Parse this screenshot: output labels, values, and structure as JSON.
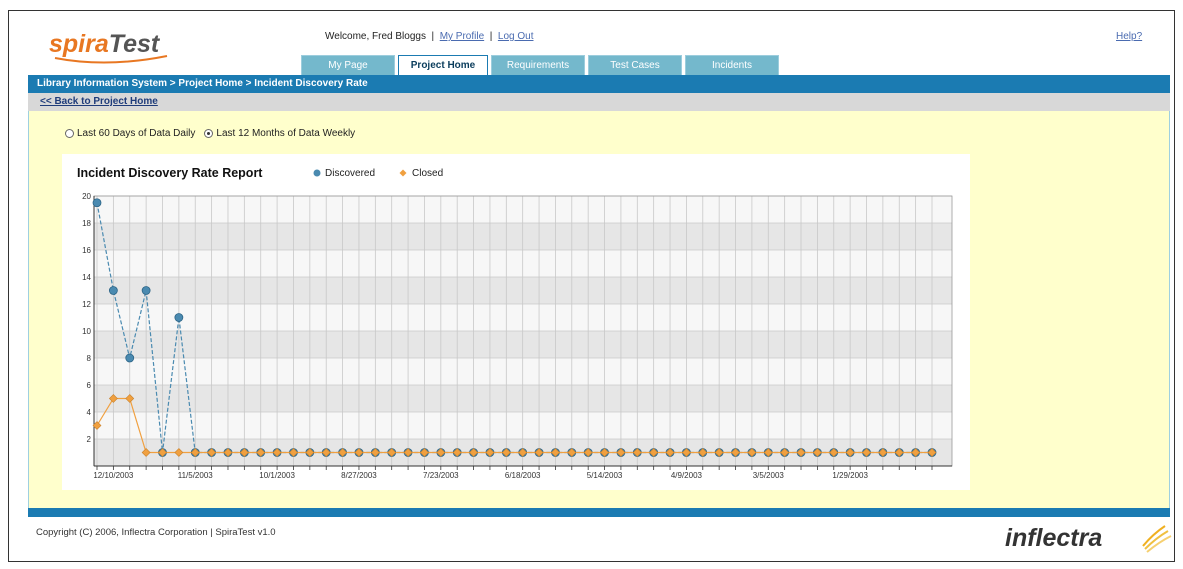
{
  "header": {
    "logo_text_1": "spira",
    "logo_text_2": "Test",
    "welcome_text": "Welcome, Fred Bloggs",
    "separator": "|",
    "my_profile": "My Profile",
    "log_out": "Log Out",
    "help": "Help?"
  },
  "tabs": [
    {
      "label": "My Page",
      "active": false
    },
    {
      "label": "Project Home",
      "active": true
    },
    {
      "label": "Requirements",
      "active": false
    },
    {
      "label": "Test Cases",
      "active": false
    },
    {
      "label": "Incidents",
      "active": false
    }
  ],
  "breadcrumb": "Library Information System > Project Home > Incident Discovery Rate",
  "back_link": "<< Back to Project Home",
  "radios": [
    {
      "label": "Last 60 Days of Data Daily",
      "checked": false
    },
    {
      "label": "Last 12 Months of Data Weekly",
      "checked": true
    }
  ],
  "footer": {
    "copyright": "Copyright (C) 2006, Inflectra Corporation | SpiraTest v1.0",
    "brand": "inflectra"
  },
  "colors": {
    "brand_blue": "#1b7bb2",
    "discovered": "#4a8ab0",
    "closed": "#f0a040"
  },
  "chart_data": {
    "type": "line",
    "title": "Incident Discovery Rate Report",
    "ylim": [
      0,
      20
    ],
    "yticks": [
      "2",
      "4",
      "6",
      "8",
      "10",
      "12",
      "14",
      "16",
      "18",
      "20"
    ],
    "xtick_labels": [
      "12/10/2003",
      "11/5/2003",
      "10/1/2003",
      "8/27/2003",
      "7/23/2003",
      "6/18/2003",
      "5/14/2003",
      "4/9/2003",
      "3/5/2003",
      "1/29/2003"
    ],
    "legend": "top",
    "grid": true,
    "series": [
      {
        "name": "Discovered",
        "color": "#4a8ab0",
        "marker": "circle",
        "values": [
          19.5,
          13,
          8,
          13,
          1,
          11,
          1,
          1,
          1,
          1,
          1,
          1,
          1,
          1,
          1,
          1,
          1,
          1,
          1,
          1,
          1,
          1,
          1,
          1,
          1,
          1,
          1,
          1,
          1,
          1,
          1,
          1,
          1,
          1,
          1,
          1,
          1,
          1,
          1,
          1,
          1,
          1,
          1,
          1,
          1,
          1,
          1,
          1,
          1,
          1,
          1,
          1
        ]
      },
      {
        "name": "Closed",
        "color": "#f0a040",
        "marker": "diamond",
        "values": [
          3,
          5,
          5,
          1,
          1,
          1,
          1,
          1,
          1,
          1,
          1,
          1,
          1,
          1,
          1,
          1,
          1,
          1,
          1,
          1,
          1,
          1,
          1,
          1,
          1,
          1,
          1,
          1,
          1,
          1,
          1,
          1,
          1,
          1,
          1,
          1,
          1,
          1,
          1,
          1,
          1,
          1,
          1,
          1,
          1,
          1,
          1,
          1,
          1,
          1,
          1,
          1
        ]
      }
    ]
  }
}
